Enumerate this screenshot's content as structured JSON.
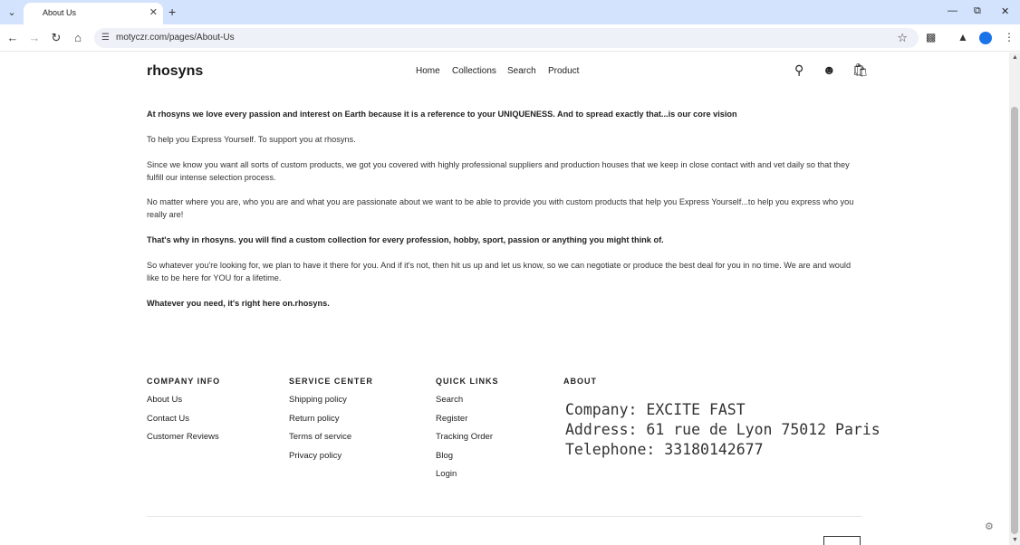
{
  "browser": {
    "tab_list_icon": "chevron-down-icon",
    "tab": {
      "title": "About Us",
      "close_icon": "close-icon"
    },
    "new_tab_icon": "plus-icon",
    "window_controls": [
      "minimize-icon",
      "restore-icon",
      "close-icon"
    ],
    "nav": [
      "back-icon",
      "forward-icon",
      "reload-icon",
      "home-icon"
    ],
    "url": "motyczr.com/pages/About-Us",
    "toolbar_icons": [
      "star-icon",
      "extensions-icon",
      "labs-icon",
      "profile-icon",
      "menu-icon"
    ]
  },
  "header": {
    "logo": "rhosyns",
    "nav": [
      "Home",
      "Collections",
      "Search",
      "Product"
    ],
    "icons": [
      "search-icon",
      "account-icon",
      "cart-icon"
    ]
  },
  "content": {
    "p1": "At rhosyns we love every passion and interest on Earth because it is a reference to your UNIQUENESS. And to spread exactly that...is our core vision",
    "p2": "To help you Express Yourself. To support you at rhosyns.",
    "p3": "Since we know you want all sorts of custom products, we got you covered with highly professional suppliers and production houses that we keep in close contact with and vet daily so that they fulfill our intense selection process.",
    "p4": "No matter where you are, who you are and what you are passionate about we want to be able to provide you with custom products that help you Express Yourself...to help you express who you really are!",
    "p5": "That's why in rhosyns. you will find a custom collection for every profession, hobby, sport, passion or anything you might think of.",
    "p6": "So whatever you're looking for, we plan to have it there for you. And if it's not, then hit us up and let us know, so we can negotiate or produce the best deal for you in no time. We are and would like to be here for YOU for a lifetime.",
    "p7": "Whatever you need, it's right here on.rhosyns."
  },
  "footer": {
    "company_info": {
      "heading": "COMPANY INFO",
      "links": [
        "About Us",
        "Contact Us",
        "Customer Reviews"
      ]
    },
    "service_center": {
      "heading": "SERVICE CENTER",
      "links": [
        "Shipping policy",
        "Return policy",
        "Terms of service",
        "Privacy policy"
      ]
    },
    "quick_links": {
      "heading": "QUICK LINKS",
      "links": [
        "Search",
        "Register",
        "Tracking Order",
        "Blog",
        "Login"
      ]
    },
    "about": {
      "heading": "ABOUT",
      "lines": [
        "Company: EXCITE FAST",
        "Address: 61 rue de Lyon 75012 Paris",
        "Telephone: 33180142677"
      ]
    }
  }
}
